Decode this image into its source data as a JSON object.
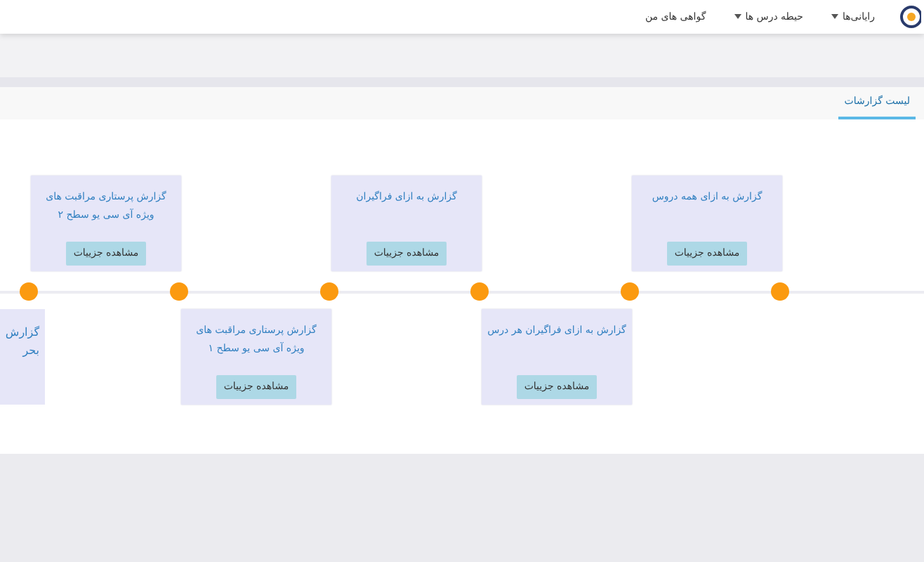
{
  "navbar": {
    "items": [
      {
        "label": "رایانی‌ها",
        "kind": "dropdown"
      },
      {
        "label": "حیطه درس ها",
        "kind": "dropdown"
      },
      {
        "label": "گواهی های من",
        "kind": "link"
      }
    ]
  },
  "tabs": [
    {
      "label": "لیست گزارشات",
      "selected": true
    }
  ],
  "timeline": {
    "items": [
      {
        "kind": "card",
        "title": "گزارش به ازای همه دروس",
        "button": "مشاهده جزییات"
      },
      {
        "kind": "card",
        "title": "گزارش به ازای فراگیران هر درس",
        "button": "مشاهده جزییات"
      },
      {
        "kind": "card",
        "title": "گزارش به ازای فراگیران",
        "button": "مشاهده جزییات"
      },
      {
        "kind": "card",
        "title": "گزارش پرستاری مراقبت های ویژه آی سی یو سطح ۱",
        "button": "مشاهده جزییات"
      },
      {
        "kind": "card",
        "title": "گزارش پرستاری مراقبت های ویژه آی سی یو سطح ۲",
        "button": "مشاهده جزییات"
      },
      {
        "kind": "partial",
        "lines": [
          "گزارش",
          "بحر"
        ]
      }
    ]
  }
}
